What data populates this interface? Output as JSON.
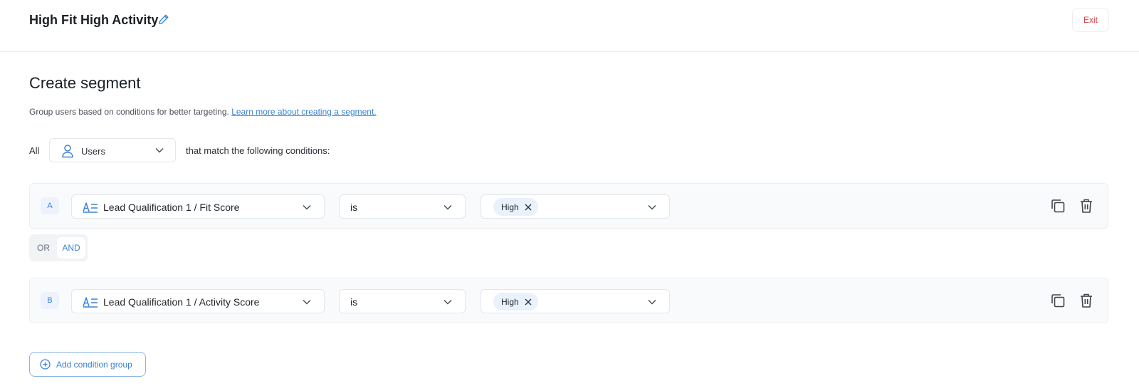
{
  "header": {
    "segment_name": "High Fit High Activity",
    "exit_label": "Exit"
  },
  "main": {
    "heading": "Create segment",
    "description": "Group users based on conditions for better targeting.",
    "learn_more_link": "Learn more about creating a segment.",
    "all_label": "All",
    "entity_select_value": "Users",
    "match_text": "that match the following conditions:"
  },
  "condition_groups": [
    {
      "letter": "A",
      "field": "Lead Qualification 1 / Fit Score",
      "operator": "is",
      "values": [
        "High"
      ]
    },
    {
      "letter": "B",
      "field": "Lead Qualification 1 / Activity Score",
      "operator": "is",
      "values": [
        "High"
      ]
    }
  ],
  "logic_toggle": {
    "options": [
      "OR",
      "AND"
    ],
    "selected": "AND"
  },
  "add_condition_group_label": "Add condition group",
  "colors": {
    "accent": "#3b82d6",
    "exit_text": "#d64545",
    "chip_bg": "#e9f1fc",
    "group_bg": "#f9fafb"
  },
  "icons": {
    "edit": "pencil-icon",
    "entity": "user-icon",
    "attribute": "text-attribute-icon",
    "copy": "copy-icon",
    "delete": "trash-icon",
    "add": "plus-circle-icon"
  }
}
